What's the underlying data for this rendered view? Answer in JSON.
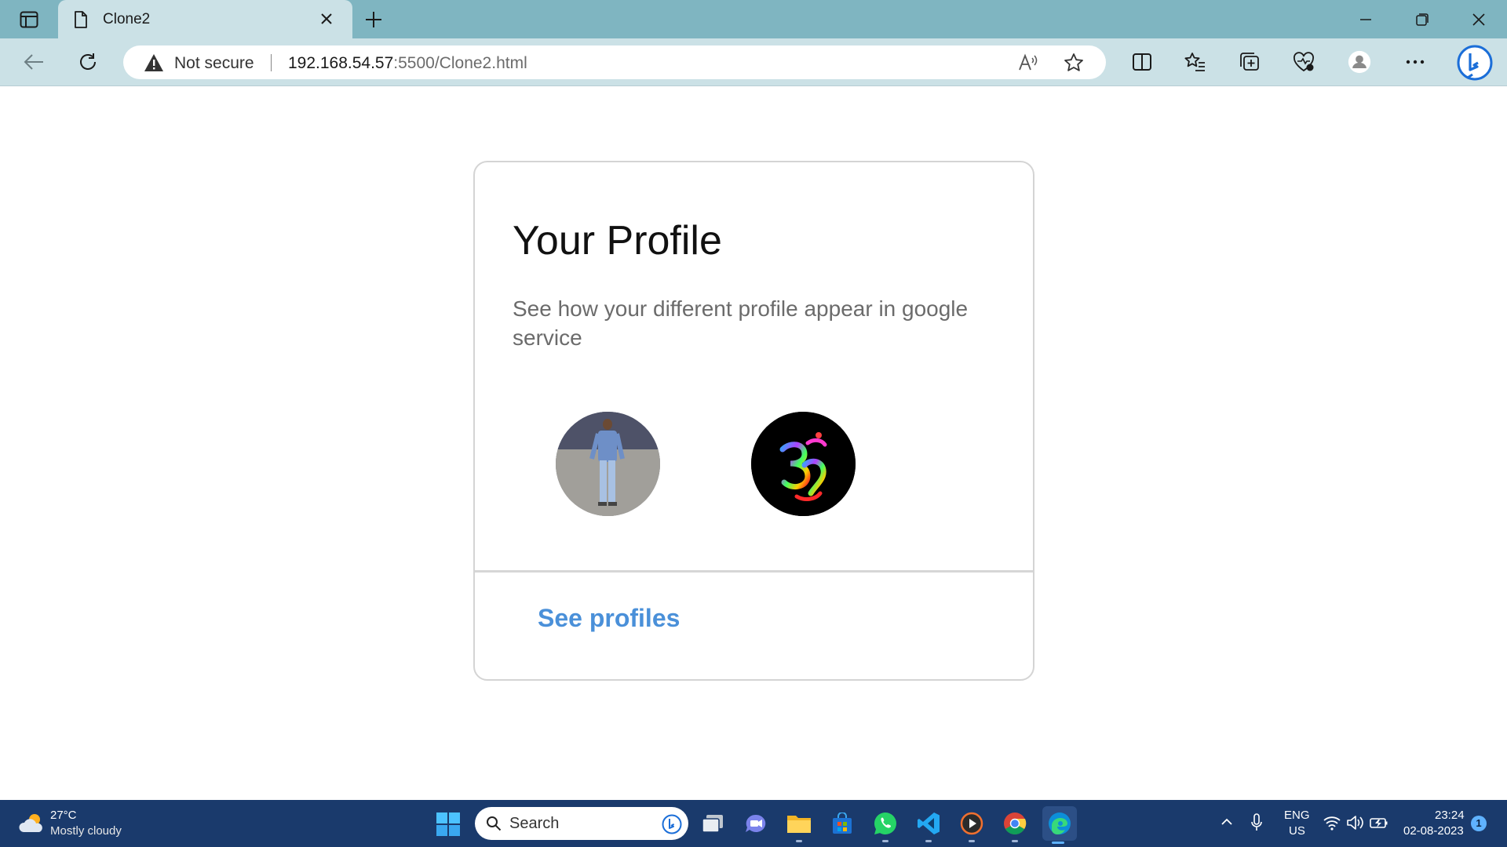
{
  "browser": {
    "tab": {
      "title": "Clone2"
    },
    "address": {
      "security_label": "Not secure",
      "url_host": "192.168.54.57",
      "url_rest": ":5500/Clone2.html"
    }
  },
  "page": {
    "title": "Your Profile",
    "description": "See how your different profile appear in google service",
    "link_label": "See profiles"
  },
  "taskbar": {
    "weather": {
      "temp": "27°C",
      "condition": "Mostly cloudy"
    },
    "search_placeholder": "Search",
    "apps": [
      "task-view",
      "teams",
      "file-explorer",
      "microsoft-store",
      "whatsapp",
      "vs-code",
      "media-player",
      "chrome",
      "edge"
    ],
    "language": {
      "line1": "ENG",
      "line2": "US"
    },
    "clock": {
      "time": "23:24",
      "date": "02-08-2023"
    },
    "notification_count": "1"
  },
  "colors": {
    "tab_strip": "#7fb5c1",
    "toolbar": "#cbe1e6",
    "link": "#4a90d9",
    "taskbar": "#1a3a6c"
  }
}
